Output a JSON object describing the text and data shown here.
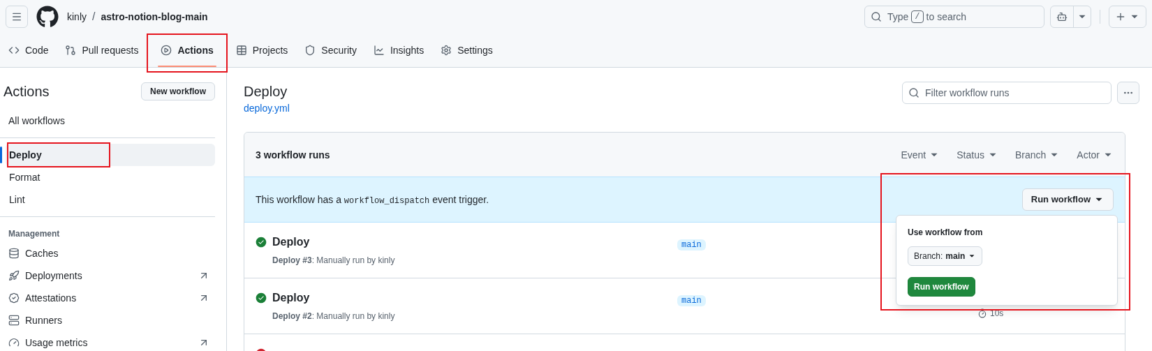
{
  "header": {
    "owner": "kinly",
    "separator": "/",
    "repo": "astro-notion-blog-main",
    "search": {
      "before": "Type",
      "key": "/",
      "after": "to search"
    }
  },
  "tabs": [
    {
      "label": "Code",
      "selected": false,
      "highlighted": false
    },
    {
      "label": "Pull requests",
      "selected": false,
      "highlighted": false
    },
    {
      "label": "Actions",
      "selected": true,
      "highlighted": true
    },
    {
      "label": "Projects",
      "selected": false,
      "highlighted": false
    },
    {
      "label": "Security",
      "selected": false,
      "highlighted": false
    },
    {
      "label": "Insights",
      "selected": false,
      "highlighted": false
    },
    {
      "label": "Settings",
      "selected": false,
      "highlighted": false
    }
  ],
  "sidebar": {
    "title": "Actions",
    "new_button": "New workflow",
    "all_workflows": "All workflows",
    "workflows": [
      {
        "label": "Deploy",
        "selected": true,
        "highlighted": true
      },
      {
        "label": "Format",
        "selected": false,
        "highlighted": false
      },
      {
        "label": "Lint",
        "selected": false,
        "highlighted": false
      }
    ],
    "management_heading": "Management",
    "management": [
      {
        "label": "Caches",
        "external": false
      },
      {
        "label": "Deployments",
        "external": true
      },
      {
        "label": "Attestations",
        "external": true
      },
      {
        "label": "Runners",
        "external": false
      },
      {
        "label": "Usage metrics",
        "external": true
      }
    ]
  },
  "main": {
    "title": "Deploy",
    "file_link": "deploy.yml",
    "filter": {
      "placeholder": "Filter workflow runs"
    },
    "runs_count": "3 workflow runs",
    "filters": [
      "Event",
      "Status",
      "Branch",
      "Actor"
    ],
    "banner": {
      "before": "This workflow has a",
      "code": "workflow_dispatch",
      "after": "event trigger.",
      "run_button": "Run workflow",
      "highlighted": true
    },
    "popover": {
      "label": "Use workflow from",
      "branch_label": "Branch:",
      "branch": "main",
      "submit": "Run workflow"
    },
    "runs": [
      {
        "kind": "success",
        "title": "Deploy",
        "subtitle": "**Deploy #3**: Manually run by kinly",
        "branch": "main"
      },
      {
        "kind": "success",
        "title": "Deploy",
        "subtitle": "**Deploy #2**: Manually run by kinly",
        "branch": "main",
        "duration": "10s"
      },
      {
        "kind": "failure"
      }
    ]
  }
}
